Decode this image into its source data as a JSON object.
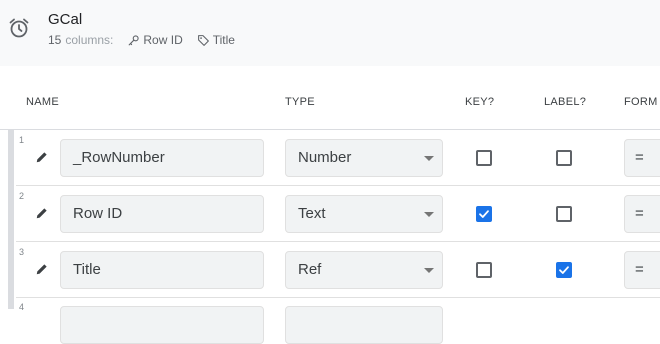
{
  "table": {
    "name": "GCal",
    "column_count": "15",
    "columns_word": "columns:",
    "key_chip": "Row ID",
    "label_chip": "Title"
  },
  "headers": {
    "name": "NAME",
    "type": "TYPE",
    "key": "KEY?",
    "label": "LABEL?",
    "formula": "FORM"
  },
  "rows": [
    {
      "num": "1",
      "name": "_RowNumber",
      "type": "Number",
      "key": false,
      "label": false,
      "formula": "="
    },
    {
      "num": "2",
      "name": "Row ID",
      "type": "Text",
      "key": true,
      "label": false,
      "formula": "="
    },
    {
      "num": "3",
      "name": "Title",
      "type": "Ref",
      "key": false,
      "label": true,
      "formula": "="
    },
    {
      "num": "4",
      "name": "",
      "type": "",
      "key": false,
      "label": false,
      "formula": ""
    }
  ],
  "colors": {
    "accent": "#1a73e8",
    "header_bg": "#f8f9fa",
    "field_bg": "#f1f3f4"
  }
}
